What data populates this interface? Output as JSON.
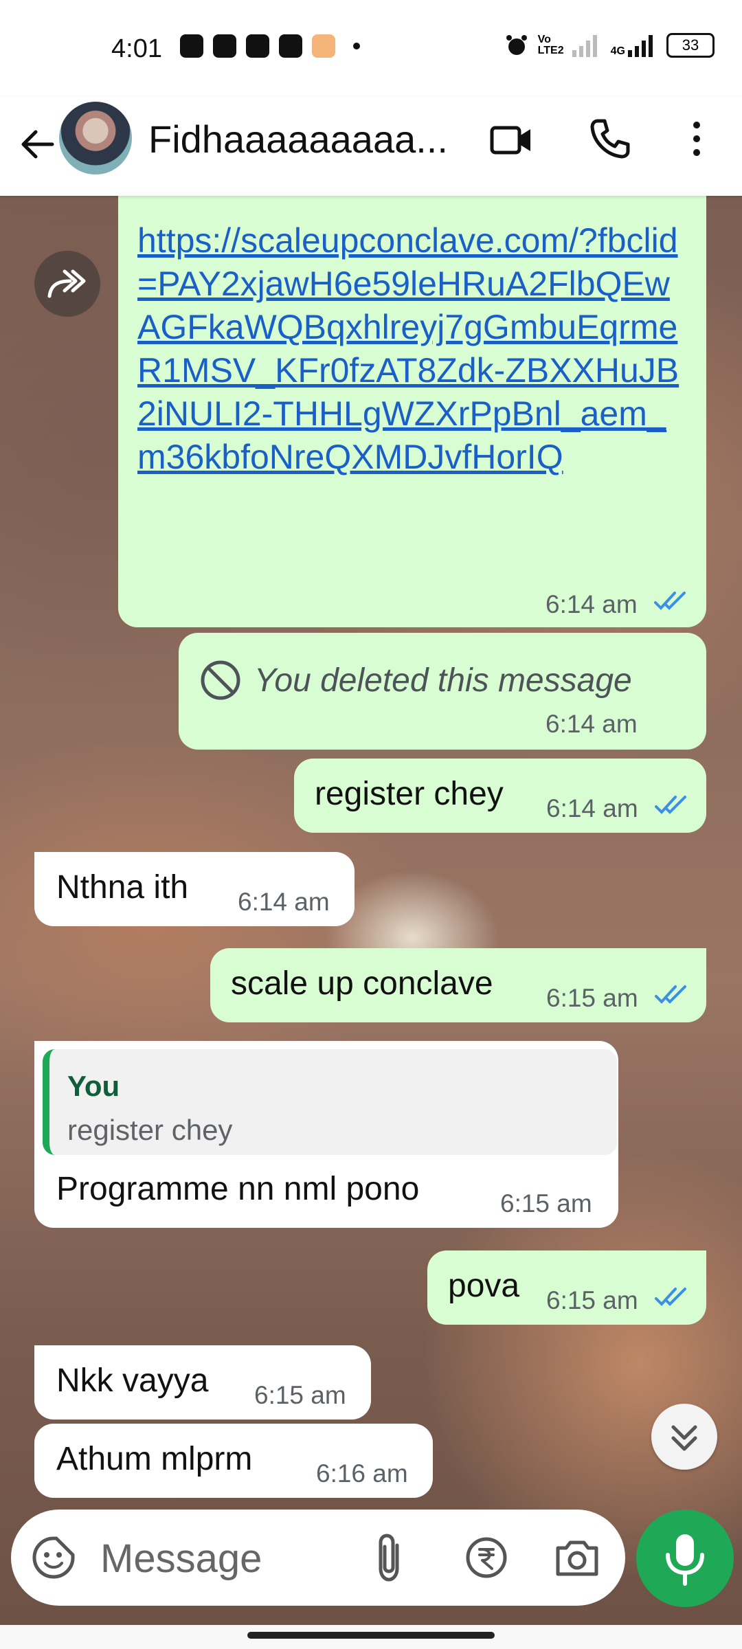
{
  "status_bar": {
    "time": "4:01",
    "battery": "33",
    "network": "4G",
    "volte": "Vo LTE2"
  },
  "header": {
    "contact_name": "Fidhaaaaaaaaa..."
  },
  "messages": [
    {
      "direction": "out",
      "type": "link",
      "text": "https://scaleupconclave.com/?fbclid=PAY2xjawH6e59leHRuA2FlbQEwAGFkaWQBqxhlreyj7gGmbuEqrmeR1MSV_KFr0fzAT8Zdk-ZBXXHuJB2iNULI2-THHLgWZXrPpBnl_aem_m36kbfoNreQXMDJvfHorIQ",
      "time": "6:14 am",
      "status": "read"
    },
    {
      "direction": "out",
      "type": "deleted",
      "text": "You deleted this message",
      "time": "6:14 am"
    },
    {
      "direction": "out",
      "text": "register chey",
      "time": "6:14 am",
      "status": "read"
    },
    {
      "direction": "in",
      "text": "Nthna ith",
      "time": "6:14 am"
    },
    {
      "direction": "out",
      "text": "scale up conclave",
      "time": "6:15 am",
      "status": "read"
    },
    {
      "direction": "in",
      "text": "Programme nn nml pono",
      "time": "6:15 am",
      "quote": {
        "author": "You",
        "text": "register chey"
      }
    },
    {
      "direction": "out",
      "text": "pova",
      "time": "6:15 am",
      "status": "read"
    },
    {
      "direction": "in",
      "text": "Nkk vayya",
      "time": "6:15 am"
    },
    {
      "direction": "in",
      "text": "Athum mlprm",
      "time": "6:16 am"
    }
  ],
  "input": {
    "placeholder": "Message"
  },
  "colors": {
    "outgoing_bubble": "#d8fdd2",
    "incoming_bubble": "#ffffff",
    "accent": "#1fa855",
    "read_ticks": "#3b8fe8",
    "link": "#1a5fc8"
  }
}
